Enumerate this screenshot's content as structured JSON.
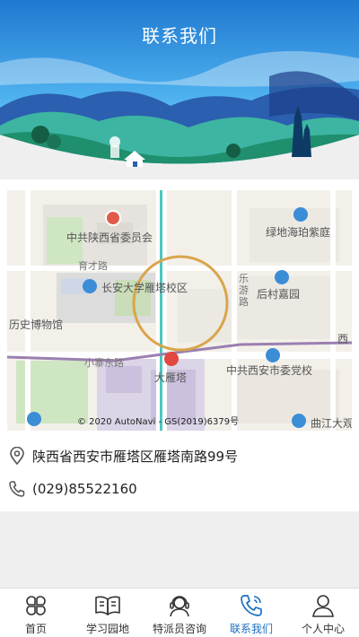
{
  "header": {
    "title": "联系我们"
  },
  "map": {
    "labels": {
      "poi_committee": "中共陕西省委员会",
      "poi_lvdi": "绿地海珀紫庭",
      "road_yucai": "育才路",
      "road_leyou": "乐游路",
      "poi_changan_univ": "长安大学雁塔校区",
      "poi_houcun": "后村嘉园",
      "poi_museum": "历史博物馆",
      "poi_xi": "西",
      "road_xiaozhai": "小寨东路",
      "poi_dayanta": "大雁塔",
      "poi_party_school": "中共西安市委党校",
      "poi_qujiang": "曲江大观"
    },
    "copyright": "© 2020 AutoNavi - GS(2019)6379号"
  },
  "contact": {
    "address": "陕西省西安市雁塔区雁塔南路99号",
    "phone": "(029)85522160"
  },
  "tabbar": {
    "items": [
      {
        "label": "首页",
        "icon": "clover-icon"
      },
      {
        "label": "学习园地",
        "icon": "book-icon"
      },
      {
        "label": "特派员咨询",
        "icon": "headset-user-icon"
      },
      {
        "label": "联系我们",
        "icon": "phone-icon"
      },
      {
        "label": "个人中心",
        "icon": "user-icon"
      }
    ],
    "active_color": "#1a6fc2"
  },
  "colors": {
    "header_sky": "#2a86d6",
    "accent": "#1a6fc2",
    "map_ring": "#d9a54a"
  }
}
